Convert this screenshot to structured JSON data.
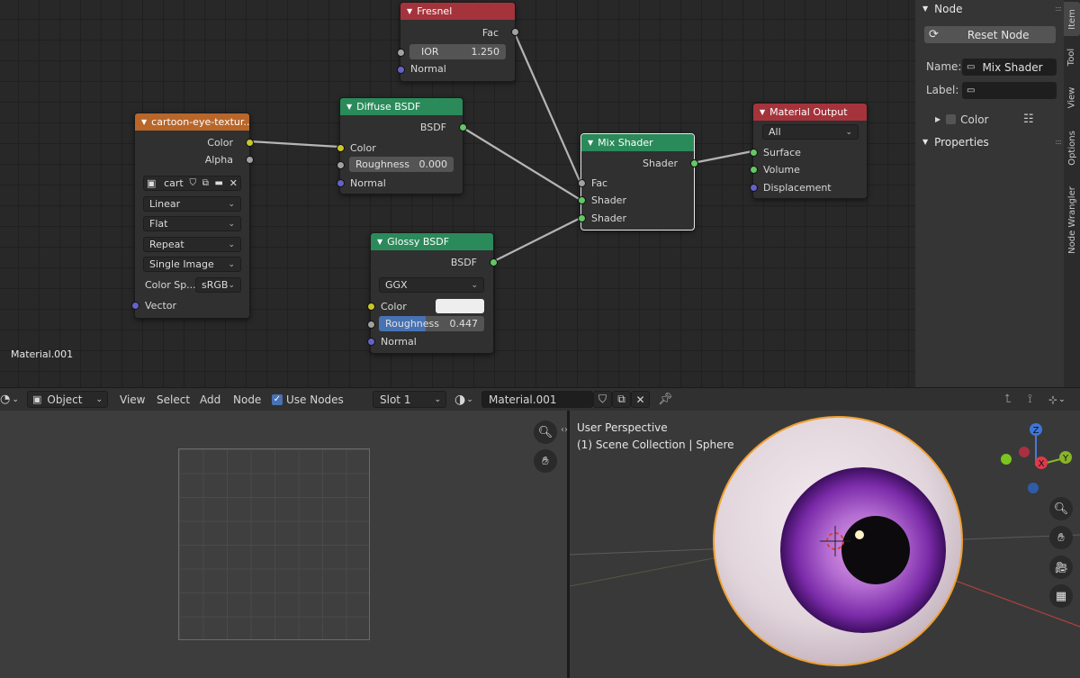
{
  "node_editor": {
    "canvas_label": "Material.001",
    "nodes": {
      "fresnel": {
        "title": "Fresnel",
        "out_fac": "Fac",
        "ior_label": "IOR",
        "ior_value": "1.250",
        "in_normal": "Normal"
      },
      "image_texture": {
        "title": "cartoon-eye-textur...",
        "out_color": "Color",
        "out_alpha": "Alpha",
        "image_name": "cart",
        "interpolation": "Linear",
        "projection": "Flat",
        "extension": "Repeat",
        "source": "Single Image",
        "colorspace_label": "Color Sp...",
        "colorspace_value": "sRGB",
        "in_vector": "Vector"
      },
      "diffuse": {
        "title": "Diffuse BSDF",
        "out_bsdf": "BSDF",
        "in_color": "Color",
        "roughness_label": "Roughness",
        "roughness_value": "0.000",
        "in_normal": "Normal"
      },
      "glossy": {
        "title": "Glossy BSDF",
        "out_bsdf": "BSDF",
        "distribution": "GGX",
        "in_color": "Color",
        "color_swatch": "#eeeeee",
        "roughness_label": "Roughness",
        "roughness_value": "0.447",
        "roughness_fraction": 0.447,
        "in_normal": "Normal"
      },
      "mix": {
        "title": "Mix Shader",
        "out_shader": "Shader",
        "in_fac": "Fac",
        "in_shader1": "Shader",
        "in_shader2": "Shader"
      },
      "output": {
        "title": "Material Output",
        "target": "All",
        "in_surface": "Surface",
        "in_volume": "Volume",
        "in_displacement": "Displacement"
      }
    }
  },
  "sidebar": {
    "node_panel_title": "Node",
    "reset_button": "Reset Node",
    "name_label": "Name:",
    "name_value": "Mix Shader",
    "label_label": "Label:",
    "label_value": "",
    "color_label": "Color",
    "properties_title": "Properties",
    "tabs": [
      "Item",
      "Tool",
      "View",
      "Options",
      "Node Wrangler"
    ]
  },
  "header_bar": {
    "mode": "Object",
    "menus": [
      "View",
      "Select",
      "Add",
      "Node"
    ],
    "use_nodes_label": "Use Nodes",
    "use_nodes_checked": true,
    "slot": "Slot 1",
    "material_name": "Material.001"
  },
  "viewport": {
    "perspective_label": "User Perspective",
    "collection_label": "(1) Scene Collection | Sphere",
    "gizmo": {
      "z": "Z",
      "y": "Y",
      "x": "X"
    }
  },
  "colors": {
    "shader_header": "#2a8a5a",
    "input_header": "#a5333c",
    "texture_header": "#b8662a",
    "selection_outline": "#e88b1e"
  }
}
